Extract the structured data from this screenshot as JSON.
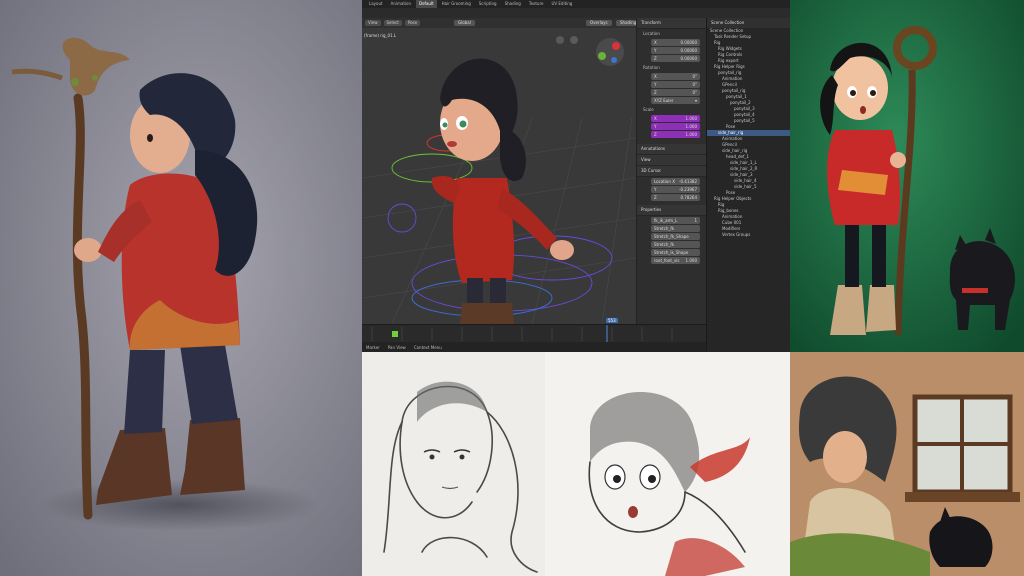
{
  "blender": {
    "tabs": [
      "Layout",
      "Animation",
      "Default",
      "Hair Grooming",
      "Scripting",
      "Shading",
      "Texture",
      "UV Editing"
    ],
    "active_tab": "Default",
    "header_buttons": [
      "View",
      "Select",
      "Pose"
    ],
    "mode": "Global",
    "overlays": "Overlays",
    "shading": "Shading",
    "viewport_label": "(frame) rig_01.L",
    "npanel": {
      "transform_header": "Transform",
      "location_label": "Location",
      "location": {
        "x": "0.00000",
        "y": "0.00000",
        "z": "0.00000"
      },
      "rotation_label": "Rotation",
      "rotation": {
        "x": "0°",
        "y": "0°",
        "z": "0°"
      },
      "mode_label": "XYZ Euler",
      "scale_label": "Scale",
      "scale": {
        "x": "1.000",
        "y": "1.000",
        "z": "1.000"
      },
      "annotations_header": "Annotations",
      "view_header": "View",
      "cursor_header": "3D Cursor",
      "cursor_location_label": "Location X",
      "cursor_location": {
        "x": "-0.41382",
        "y": "-0.23967",
        "z": "0.78264"
      },
      "properties_header": "Properties",
      "properties": [
        "fk_ik_arm_L",
        "Stretch_fk",
        "Stretch_fk_Shape",
        "Stretch_fk",
        "Stretch_ik_Shape",
        "root_foot_vis"
      ],
      "property_values": [
        "1",
        "",
        "",
        "",
        "",
        "1.000"
      ]
    },
    "outliner": {
      "title": "Scene Collection",
      "items": [
        "Scene Collection",
        "Task Render Setup",
        "Rig",
        "Rig Widgets",
        "Rig Controls",
        "Rig export",
        "Rig Helper Rigs",
        "ponytail_rig",
        "Animation",
        "GPencil",
        "ponytail_rig",
        "ponytail_1",
        "ponytail_2",
        "ponytail_3",
        "ponytail_4",
        "ponytail_5",
        "Pose",
        "side_hair_rig",
        "Animation",
        "GPencil",
        "side_hair_rig",
        "head_def_1",
        "side_hair_1_L",
        "side_hair_2_R",
        "side_hair_3",
        "side_hair_4",
        "side_hair_5",
        "Pose",
        "Rig Helper Objects",
        "Rig",
        "Rig_bones",
        "Animation",
        "Cube 001",
        "Modifiers",
        "Vertex Groups"
      ],
      "selected_index": 17
    },
    "current_frame": "553",
    "status": {
      "left": "Marker",
      "mode": "Pan View",
      "context": "Context Menu"
    }
  }
}
